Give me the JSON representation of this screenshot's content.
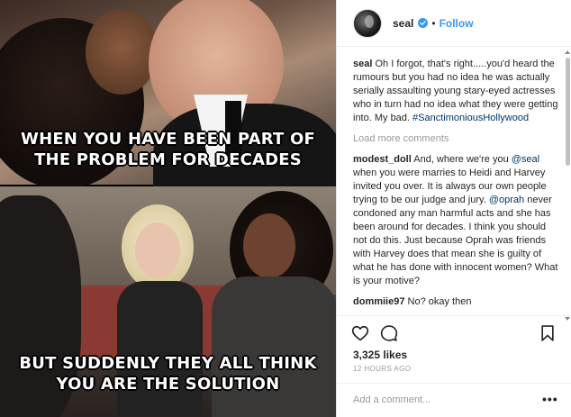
{
  "media": {
    "caption_top_line1": "WHEN YOU HAVE BEEN PART OF",
    "caption_top_line2": "THE PROBLEM FOR DECADES",
    "caption_bottom_line1": "BUT SUDDENLY THEY ALL THINK",
    "caption_bottom_line2": "YOU ARE THE SOLUTION"
  },
  "header": {
    "username": "seal",
    "verified_icon": "verified-badge-icon",
    "separator": "•",
    "follow_label": "Follow"
  },
  "comments": {
    "caption": {
      "author": "seal",
      "text": "Oh I forgot, that's right.....you'd heard the rumours but you had no idea he was actually serially assaulting young stary-eyed actresses who in turn had no idea what they were getting into. My bad.",
      "hashtag": "#SanctimoniousHollywood"
    },
    "load_more_label": "Load more comments",
    "items": [
      {
        "author": "modest_doll",
        "text_1": "And, where we're you",
        "mention_1": "@seal",
        "text_2": "when you were marries to Heidi and Harvey invited you over. It is always our own people trying to be our judge and jury.",
        "mention_2": "@oprah",
        "text_3": "never condoned any man harmful acts and she has been around for decades. I think you should not do this. Just because Oprah was friends with Harvey does that mean she is guilty of what he has done with innocent women? What is your motive?"
      },
      {
        "author": "dommiie97",
        "text": "No? okay then"
      }
    ]
  },
  "actions": {
    "like_icon": "heart-icon",
    "comment_icon": "comment-icon",
    "save_icon": "bookmark-icon",
    "likes_count": "3,325 likes",
    "timestamp": "12 HOURS AGO"
  },
  "add_comment": {
    "placeholder": "Add a comment...",
    "more_label": "•••"
  },
  "colors": {
    "link_blue": "#3897f0",
    "mention": "#003569",
    "muted": "#999999",
    "text": "#262626"
  }
}
